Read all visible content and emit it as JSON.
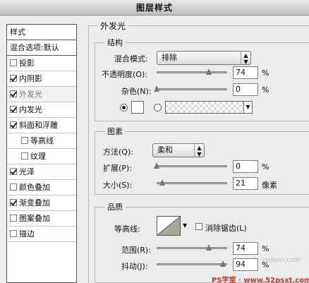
{
  "window": {
    "title": "图层样式"
  },
  "sidebar": {
    "header": "样式",
    "blend_options": "混合选项:默认",
    "items": [
      {
        "label": "投影",
        "checked": false,
        "sub": false,
        "active": false
      },
      {
        "label": "内阴影",
        "checked": true,
        "sub": false,
        "active": false
      },
      {
        "label": "外发光",
        "checked": true,
        "sub": false,
        "active": true
      },
      {
        "label": "内发光",
        "checked": true,
        "sub": false,
        "active": false
      },
      {
        "label": "斜面和浮雕",
        "checked": true,
        "sub": false,
        "active": false
      },
      {
        "label": "等高线",
        "checked": false,
        "sub": true,
        "active": false
      },
      {
        "label": "纹理",
        "checked": false,
        "sub": true,
        "active": false
      },
      {
        "label": "光泽",
        "checked": true,
        "sub": false,
        "active": false
      },
      {
        "label": "颜色叠加",
        "checked": false,
        "sub": false,
        "active": false
      },
      {
        "label": "渐变叠加",
        "checked": true,
        "sub": false,
        "active": false
      },
      {
        "label": "图案叠加",
        "checked": false,
        "sub": false,
        "active": false
      },
      {
        "label": "描边",
        "checked": false,
        "sub": false,
        "active": false
      }
    ]
  },
  "outer_glow": {
    "title": "外发光",
    "structure": {
      "title": "结构",
      "blend_mode_label": "混合模式:",
      "blend_mode_value": "排除",
      "opacity_label": "不透明度(O):",
      "opacity_value": "74",
      "opacity_fraction": 0.74,
      "noise_label": "杂色(N):",
      "noise_value": "0",
      "noise_fraction": 0.0,
      "percent": "%"
    },
    "elements": {
      "title": "图素",
      "technique_label": "方法(Q):",
      "technique_value": "柔和",
      "spread_label": "扩展(P):",
      "spread_value": "0",
      "spread_fraction": 0.0,
      "size_label": "大小(S):",
      "size_value": "21",
      "size_fraction": 0.08,
      "percent": "%",
      "px_unit": "像素"
    },
    "quality": {
      "title": "品质",
      "contour_label": "等高线:",
      "antialias_label": "消除锯齿(L)",
      "range_label": "范围(R):",
      "range_value": "74",
      "range_fraction": 0.74,
      "jitter_label": "抖动(J):",
      "jitter_value": "94",
      "jitter_fraction": 0.94,
      "percent": "%"
    }
  },
  "watermarks": {
    "site1": "tedeon.com",
    "site2": "PS学堂 · www.52psxt.com"
  }
}
